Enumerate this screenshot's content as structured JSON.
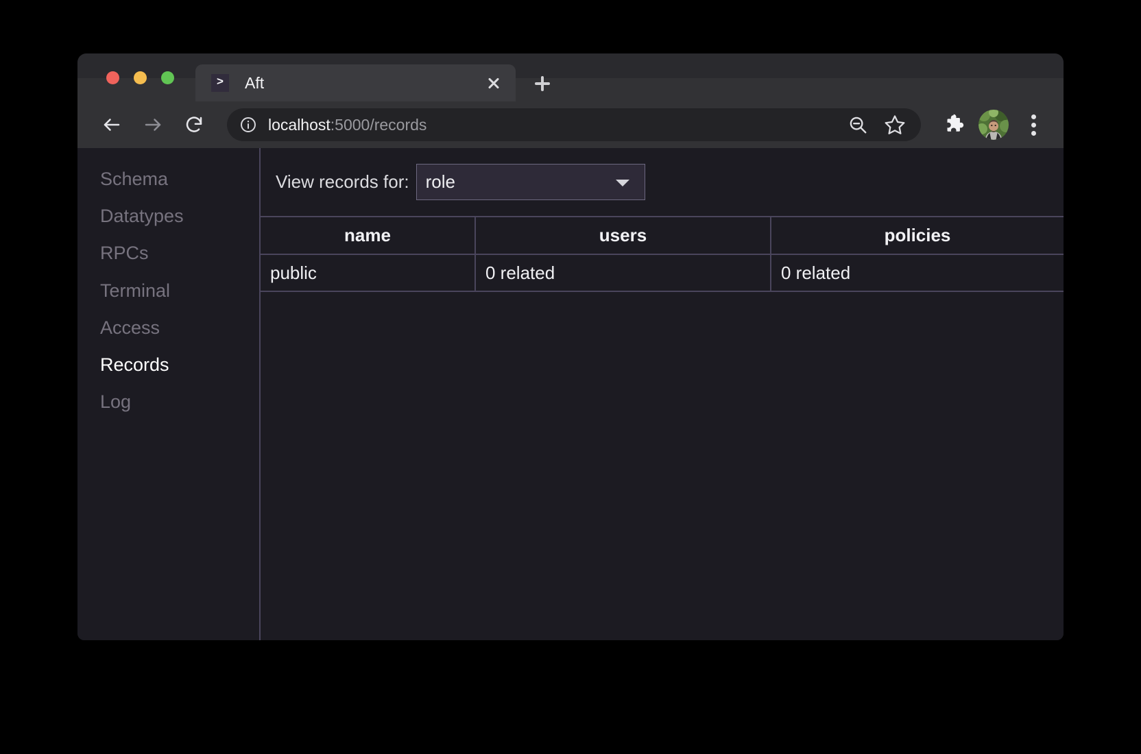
{
  "window": {
    "traffic_lights": [
      "close",
      "minimize",
      "zoom"
    ],
    "colors": {
      "close": "#f0635c",
      "minimize": "#f5bd4f",
      "zoom": "#61c554",
      "window_bg": "#1c1b22",
      "toolbar_bg": "#323235",
      "tabstrip_bg": "#2a2a2e",
      "active_tab_bg": "#3b3b3f",
      "accent_border": "#4a455c",
      "select_bg": "#2e2a38",
      "favicon_bg": "#312c3c",
      "active_item": "#ffffff",
      "muted_item": "#77737f"
    }
  },
  "tab": {
    "favicon_glyph": ">",
    "favicon_name": "terminal-prompt-icon",
    "title": "Aft",
    "close_label": "Close tab",
    "new_tab_label": "New tab"
  },
  "toolbar": {
    "back_label": "Back",
    "forward_label": "Forward",
    "reload_label": "Reload",
    "site_info_label": "View site information",
    "url_host": "localhost",
    "url_rest": ":5000/records",
    "url_full": "localhost:5000/records",
    "zoom_out_label": "Zoom out",
    "bookmark_label": "Bookmark this tab",
    "extensions_label": "Extensions",
    "profile_label": "Profile",
    "menu_label": "Customize and control"
  },
  "sidebar": {
    "items": [
      {
        "label": "Schema",
        "active": false
      },
      {
        "label": "Datatypes",
        "active": false
      },
      {
        "label": "RPCs",
        "active": false
      },
      {
        "label": "Terminal",
        "active": false
      },
      {
        "label": "Access",
        "active": false
      },
      {
        "label": "Records",
        "active": true
      },
      {
        "label": "Log",
        "active": false
      }
    ]
  },
  "main": {
    "filter_label": "View records for:",
    "selected_record_type": "role",
    "record_type_options": [
      "role"
    ],
    "table": {
      "columns": [
        "name",
        "users",
        "policies"
      ],
      "rows": [
        [
          "public",
          "0 related",
          "0 related"
        ]
      ]
    }
  }
}
